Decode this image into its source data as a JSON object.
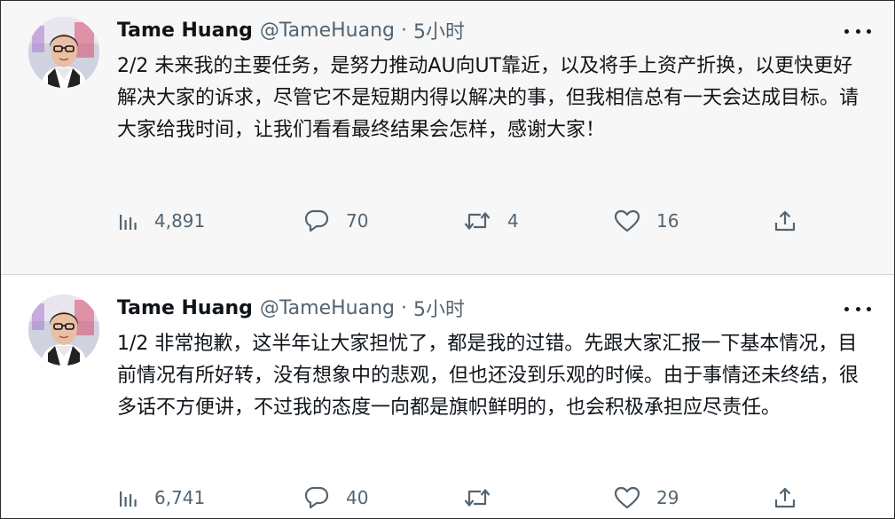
{
  "tweets": [
    {
      "author_name": "Tame Huang",
      "handle": "@TameHuang",
      "separator": "·",
      "time": "5小时",
      "text": "2/2 未来我的主要任务，是努力推动AU向UT靠近，以及将手上资产折换，以更快更好解决大家的诉求，尽管它不是短期内得以解决的事，但我相信总有一天会达成目标。请大家给我时间，让我们看看最终结果会怎样，感谢大家！",
      "views": "4,891",
      "replies": "70",
      "retweets": "4",
      "likes": "16"
    },
    {
      "author_name": "Tame Huang",
      "handle": "@TameHuang",
      "separator": "·",
      "time": "5小时",
      "text": "1/2 非常抱歉，这半年让大家担忧了，都是我的过错。先跟大家汇报一下基本情况，目前情况有所好转，没有想象中的悲观，但也还没到乐观的时候。由于事情还未终结，很多话不方便讲，不过我的态度一向都是旗帜鲜明的，也会积极承担应尽责任。",
      "views": "6,741",
      "replies": "40",
      "retweets": "",
      "likes": "29"
    }
  ],
  "icons": {
    "views": "analytics-icon",
    "reply": "reply-icon",
    "retweet": "retweet-icon",
    "like": "heart-icon",
    "share": "share-icon",
    "more": "more-icon"
  },
  "colors": {
    "text": "#0f1419",
    "secondary": "#536471",
    "tweet1_bg": "#f7f7f7",
    "tweet2_bg": "#ffffff"
  }
}
